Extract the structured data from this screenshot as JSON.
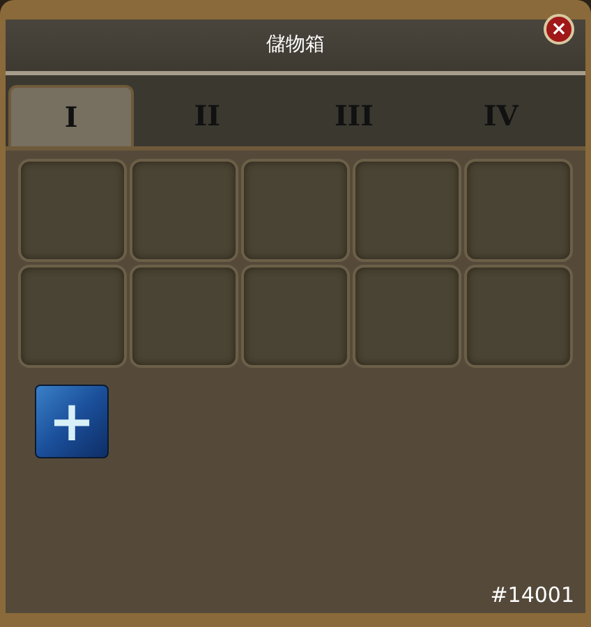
{
  "window": {
    "title": "儲物箱",
    "close": "×"
  },
  "tabs": [
    {
      "label": "I",
      "selected": true
    },
    {
      "label": "II",
      "selected": false
    },
    {
      "label": "III",
      "selected": false
    },
    {
      "label": "IV",
      "selected": false
    }
  ],
  "slots": [
    {
      "kind": "empty"
    },
    {
      "kind": "empty"
    },
    {
      "kind": "empty"
    },
    {
      "kind": "empty"
    },
    {
      "kind": "empty"
    },
    {
      "kind": "empty"
    },
    {
      "kind": "empty"
    },
    {
      "kind": "empty"
    },
    {
      "kind": "empty"
    },
    {
      "kind": "empty"
    }
  ],
  "add_button": {
    "label": "+"
  },
  "footer_code": "#14001"
}
